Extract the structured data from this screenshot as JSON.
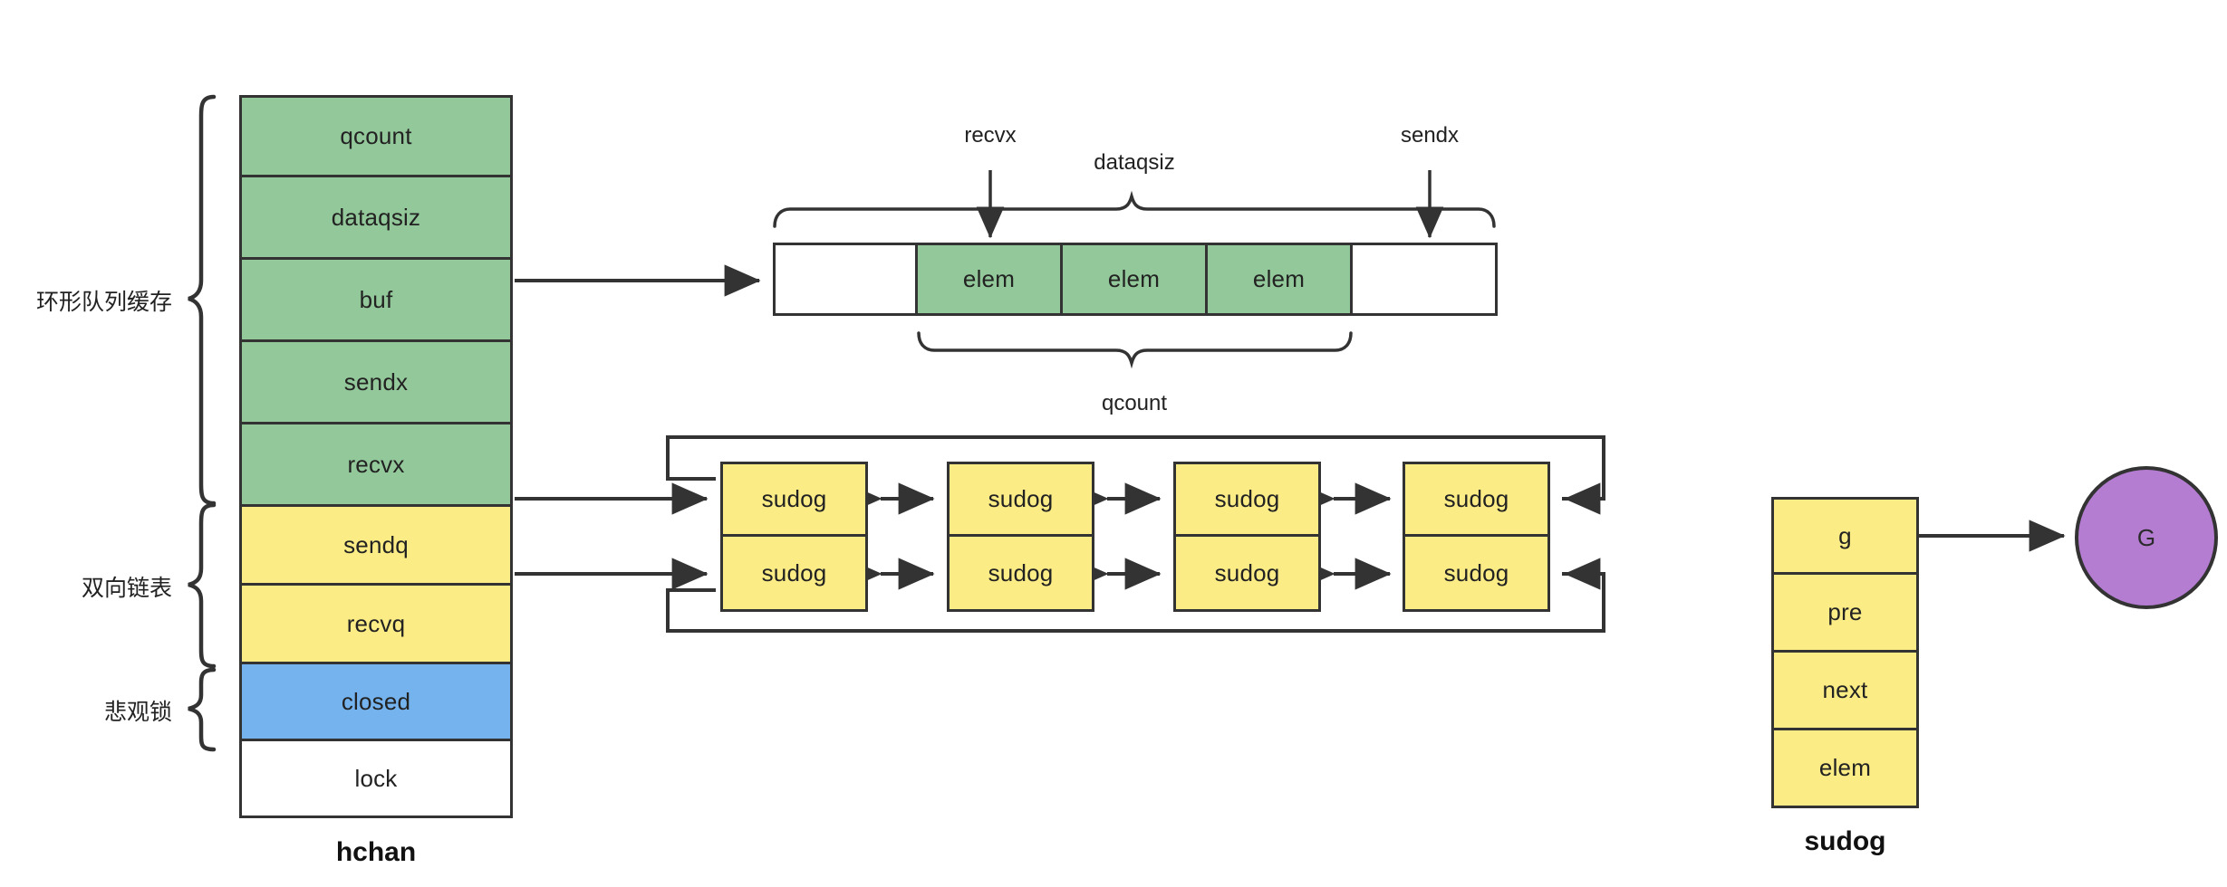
{
  "diagram": {
    "title_hchan": "hchan",
    "title_sudog": "sudog"
  },
  "hchan": {
    "caption": "hchan",
    "fields": [
      {
        "label": "qcount",
        "color": "green"
      },
      {
        "label": "dataqsiz",
        "color": "green"
      },
      {
        "label": "buf",
        "color": "green"
      },
      {
        "label": "sendx",
        "color": "green"
      },
      {
        "label": "recvx",
        "color": "green"
      },
      {
        "label": "sendq",
        "color": "yellow"
      },
      {
        "label": "recvq",
        "color": "yellow"
      },
      {
        "label": "closed",
        "color": "blue"
      },
      {
        "label": "lock",
        "color": "white"
      }
    ],
    "groups": [
      {
        "label": "环形队列缓存"
      },
      {
        "label": "双向链表"
      },
      {
        "label": "悲观锁"
      }
    ]
  },
  "ringbuffer": {
    "slots": [
      {
        "label": "",
        "color": "white"
      },
      {
        "label": "elem",
        "color": "green"
      },
      {
        "label": "elem",
        "color": "green"
      },
      {
        "label": "elem",
        "color": "green"
      },
      {
        "label": "",
        "color": "white"
      }
    ],
    "pointer_recvx": "recvx",
    "pointer_sendx": "sendx",
    "span_dataqsiz": "dataqsiz",
    "span_qcount": "qcount"
  },
  "waitqueues": {
    "sendq_row": [
      "sudog",
      "sudog",
      "sudog",
      "sudog"
    ],
    "recvq_row": [
      "sudog",
      "sudog",
      "sudog",
      "sudog"
    ]
  },
  "sudog": {
    "caption": "sudog",
    "fields": [
      {
        "label": "g"
      },
      {
        "label": "pre"
      },
      {
        "label": "next"
      },
      {
        "label": "elem"
      }
    ],
    "goroutine": "G"
  },
  "colors": {
    "green": "#93c99a",
    "yellow": "#fbec86",
    "blue": "#74b3ee",
    "purple": "#b47dd2",
    "stroke": "#333333",
    "background": "#ffffff"
  }
}
